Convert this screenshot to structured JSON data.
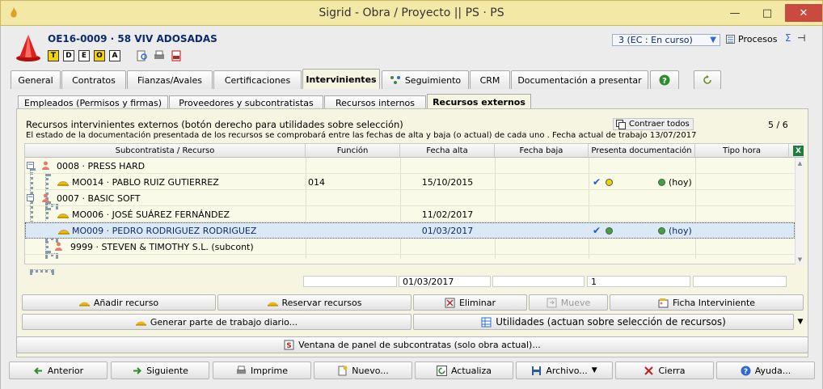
{
  "window": {
    "title": "Sigrid - Obra / Proyecto || PS · PS"
  },
  "header": {
    "project": "OE16-0009 · 58 VIV ADOSADAS",
    "icons": [
      "T",
      "D",
      "E",
      "O",
      "A"
    ],
    "status": "3 (EC : En curso)",
    "procesos_label": "Procesos"
  },
  "tabs": [
    {
      "label": "General"
    },
    {
      "label": "Contratos"
    },
    {
      "label": "Fianzas/Avales"
    },
    {
      "label": "Certificaciones"
    },
    {
      "label": "Intervinientes"
    },
    {
      "label": "Seguimiento"
    },
    {
      "label": "CRM"
    },
    {
      "label": "Documentación a presentar"
    }
  ],
  "subtabs": [
    {
      "label": "Empleados (Permisos y firmas)"
    },
    {
      "label": "Proveedores y subcontratistas"
    },
    {
      "label": "Recursos internos"
    },
    {
      "label": "Recursos externos"
    }
  ],
  "panel": {
    "title": "Recursos intervinientes externos (botón derecho para utilidades sobre selección)",
    "note": "El estado de la documentación presentada de los recursos se comprobará entre las fechas de alta y baja (o actual) de cada uno .  Fecha actual de trabajo 13/07/2017",
    "contraer_label": "Contraer todos",
    "counter": "5 / 6"
  },
  "grid": {
    "columns": [
      "Subcontratista / Recurso",
      "Función",
      "Fecha alta",
      "Fecha baja",
      "Presenta documentación",
      "Tipo hora"
    ],
    "rows": [
      {
        "name": "0008 · PRESS HARD",
        "funcion": "",
        "alta": "",
        "baja": "",
        "hoy": ""
      },
      {
        "name": "MO014 · PABLO RUIZ GUTIERREZ",
        "funcion": "014",
        "alta": "15/10/2015",
        "baja": "",
        "hoy": "(hoy)"
      },
      {
        "name": "0007 · BASIC SOFT",
        "funcion": "",
        "alta": "",
        "baja": "",
        "hoy": ""
      },
      {
        "name": "MO006 · JOSÉ SUÁREZ FERNÁNDEZ",
        "funcion": "",
        "alta": "11/02/2017",
        "baja": "",
        "hoy": ""
      },
      {
        "name": "MO009 · PEDRO RODRIGUEZ RODRIGUEZ",
        "funcion": "",
        "alta": "01/03/2017",
        "baja": "",
        "hoy": "(hoy)"
      },
      {
        "name": "9999 · STEVEN & TIMOTHY S.L. (subcont)",
        "funcion": "",
        "alta": "",
        "baja": "",
        "hoy": ""
      }
    ],
    "totals": {
      "alta": "01/03/2017",
      "doc": "1"
    }
  },
  "actions": {
    "anadir": "Añadir recurso",
    "reservar": "Reservar recursos",
    "eliminar": "Eliminar",
    "mueve": "Mueve",
    "ficha": "Ficha Interviniente",
    "generar": "Generar parte de trabajo diario...",
    "utilidades": "Utilidades (actuan sobre selección de recursos)",
    "ventana": "Ventana de panel de subcontratas (solo obra actual)..."
  },
  "footer": {
    "anterior": "Anterior",
    "siguiente": "Siguiente",
    "imprime": "Imprime",
    "nuevo": "Nuevo...",
    "actualiza": "Actualiza",
    "archivo": "Archivo...",
    "cierra": "Cierra",
    "ayuda": "Ayuda..."
  },
  "colors": {
    "accent": "#2c6bd6",
    "panel": "#f6f5e2",
    "title_bar": "#f4e8a6",
    "close": "#c94b3f"
  }
}
